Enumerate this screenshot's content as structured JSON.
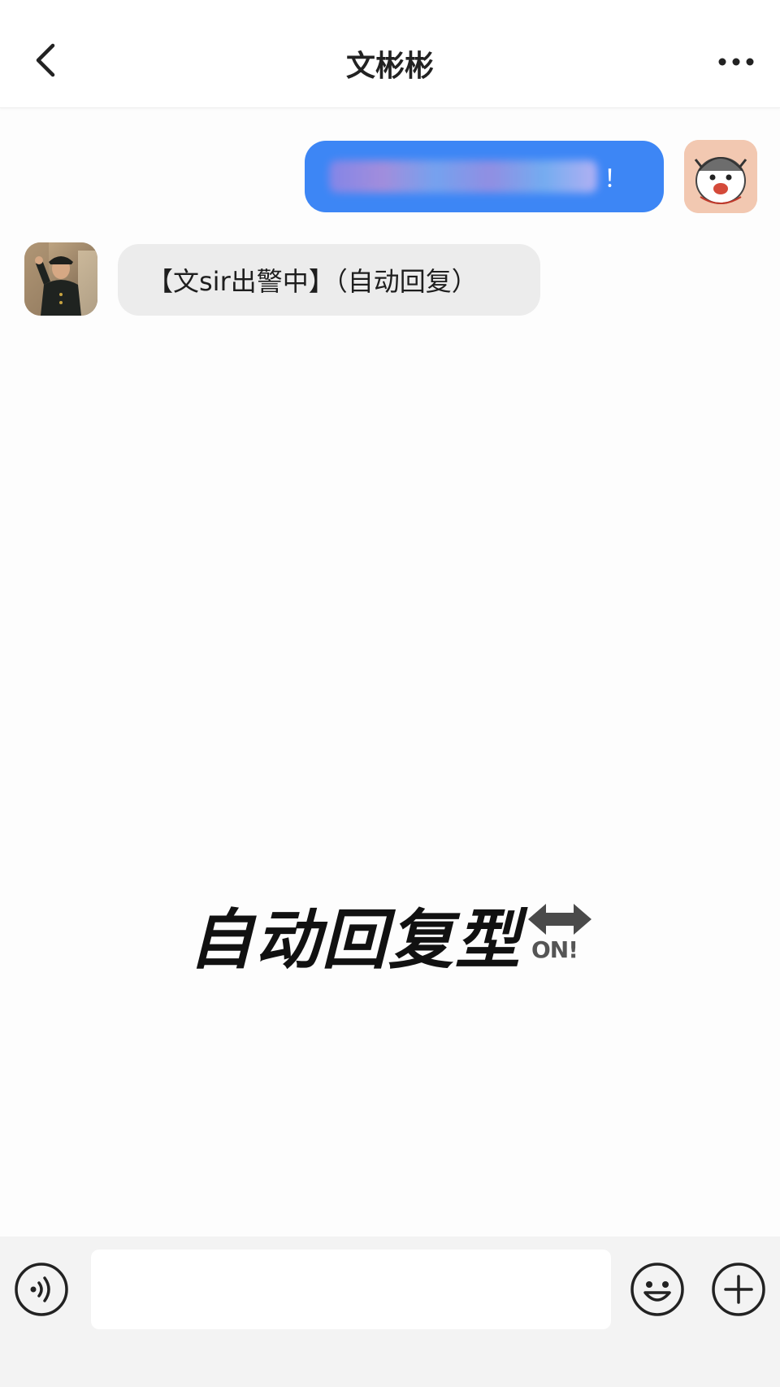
{
  "header": {
    "title": "文彬彬"
  },
  "messages": [
    {
      "direction": "outgoing",
      "text": "！",
      "text_blurred": true
    },
    {
      "direction": "incoming",
      "text": "【文sir出警中】（自动回复）"
    }
  ],
  "caption": {
    "text": "自动回复型",
    "badge": "ON!"
  },
  "input": {
    "value": "",
    "placeholder": ""
  },
  "colors": {
    "outgoing_bubble": "#3d86f5",
    "incoming_bubble": "#ececec",
    "input_bar": "#f3f3f3"
  },
  "icons": [
    "back-icon",
    "more-icon",
    "voice-icon",
    "emoji-icon",
    "plus-icon"
  ]
}
